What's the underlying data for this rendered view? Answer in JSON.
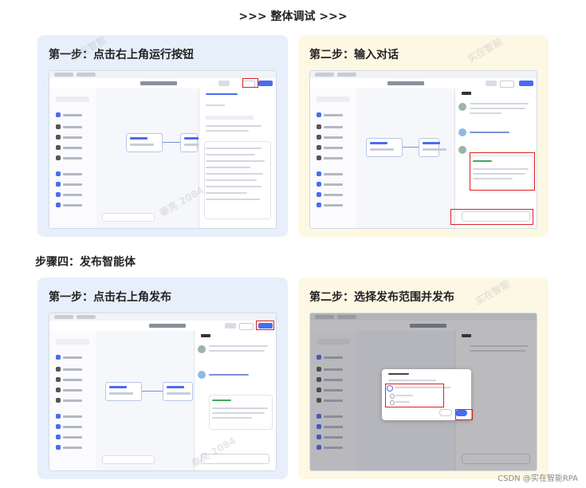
{
  "header": {
    "title": ">>> 整体调试 >>>"
  },
  "section2": {
    "title": "步骤四：发布智能体"
  },
  "cards": {
    "c1": {
      "title": "第一步：点击右上角运行按钮"
    },
    "c2": {
      "title": "第二步：输入对话"
    },
    "c3": {
      "title": "第一步：点击右上角发布"
    },
    "c4": {
      "title": "第二步：选择发布范围并发布"
    }
  },
  "watermarks": {
    "text1": "实在智能",
    "text2": "秦亮 2084"
  },
  "footer": {
    "credit": "CSDN @实在智能RPA"
  },
  "colors": {
    "accent": "#4a6cf0",
    "highlight": "#e02020",
    "card_blue": "#e7effb",
    "card_yellow": "#fdf8e4"
  }
}
